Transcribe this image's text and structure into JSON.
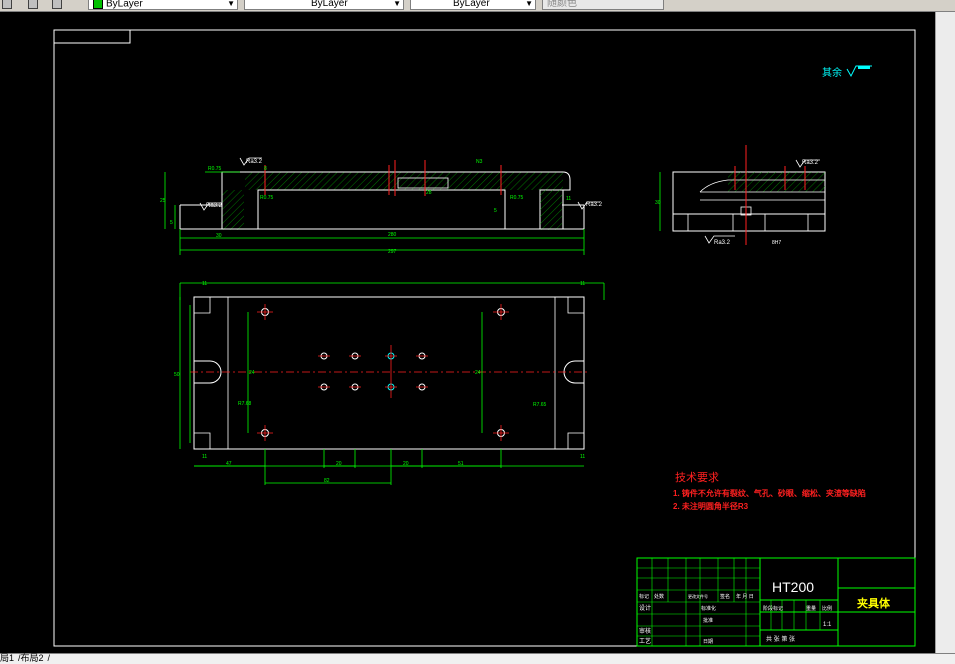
{
  "toolbar": {
    "color_value": "ByLayer",
    "linetype_value": "ByLayer",
    "lineweight_value": "ByLayer",
    "plotstyle_value": "随颜色",
    "layer_color": "#00c000"
  },
  "layout_tabs": [
    "局1",
    "布局2"
  ],
  "drawing": {
    "surface_finish_note": "其余",
    "roughness": {
      "a": "Ra3.2",
      "b": "Ra3.2",
      "c": "Ra3.2",
      "d": "Ra3.2"
    },
    "front_dims": {
      "r6": "R0.75",
      "w1": "8",
      "w2": "N3",
      "h_left": "25",
      "h_right": "5",
      "r_left": "R0.75",
      "r_right": "R0.75",
      "inner": "30",
      "d270": "280",
      "d297": "297",
      "h2": "28",
      "left_small": "5",
      "right_small": "11"
    },
    "top_dims": {
      "t1": "11",
      "t2": "11",
      "w47": "47",
      "w20a": "20",
      "w20b": "20",
      "w51": "51",
      "w82": "82",
      "left_h": "50",
      "inner_left": "24",
      "inner_right": "24",
      "r_left": "R7.68",
      "r_right": "R7.65",
      "b11": "11",
      "b12": "11"
    },
    "side_dims": {
      "h": "30",
      "roughness_top": "Ra3.2",
      "roughness_bottom": "Ra3.2",
      "note": "8H7"
    }
  },
  "tech_req": {
    "title": "技术要求",
    "line1": "1. 铸件不允许有裂纹、气孔、砂眼、缩松、夹渣等缺陷",
    "line2": "2. 未注明圆角半径R3"
  },
  "title_block": {
    "material": "HT200",
    "part_name": "夹具体",
    "scale": "1:1",
    "header_labels": [
      "标记",
      "处数",
      "更改文件号",
      "签名",
      "年 月 日"
    ],
    "row_labels": [
      "设计",
      "审核",
      "工艺"
    ],
    "mid_labels": [
      "标准化",
      "批准",
      "日期"
    ],
    "stage_labels": [
      "阶段标记",
      "重量",
      "比例"
    ],
    "sheet_label": "共 张 第 张"
  }
}
